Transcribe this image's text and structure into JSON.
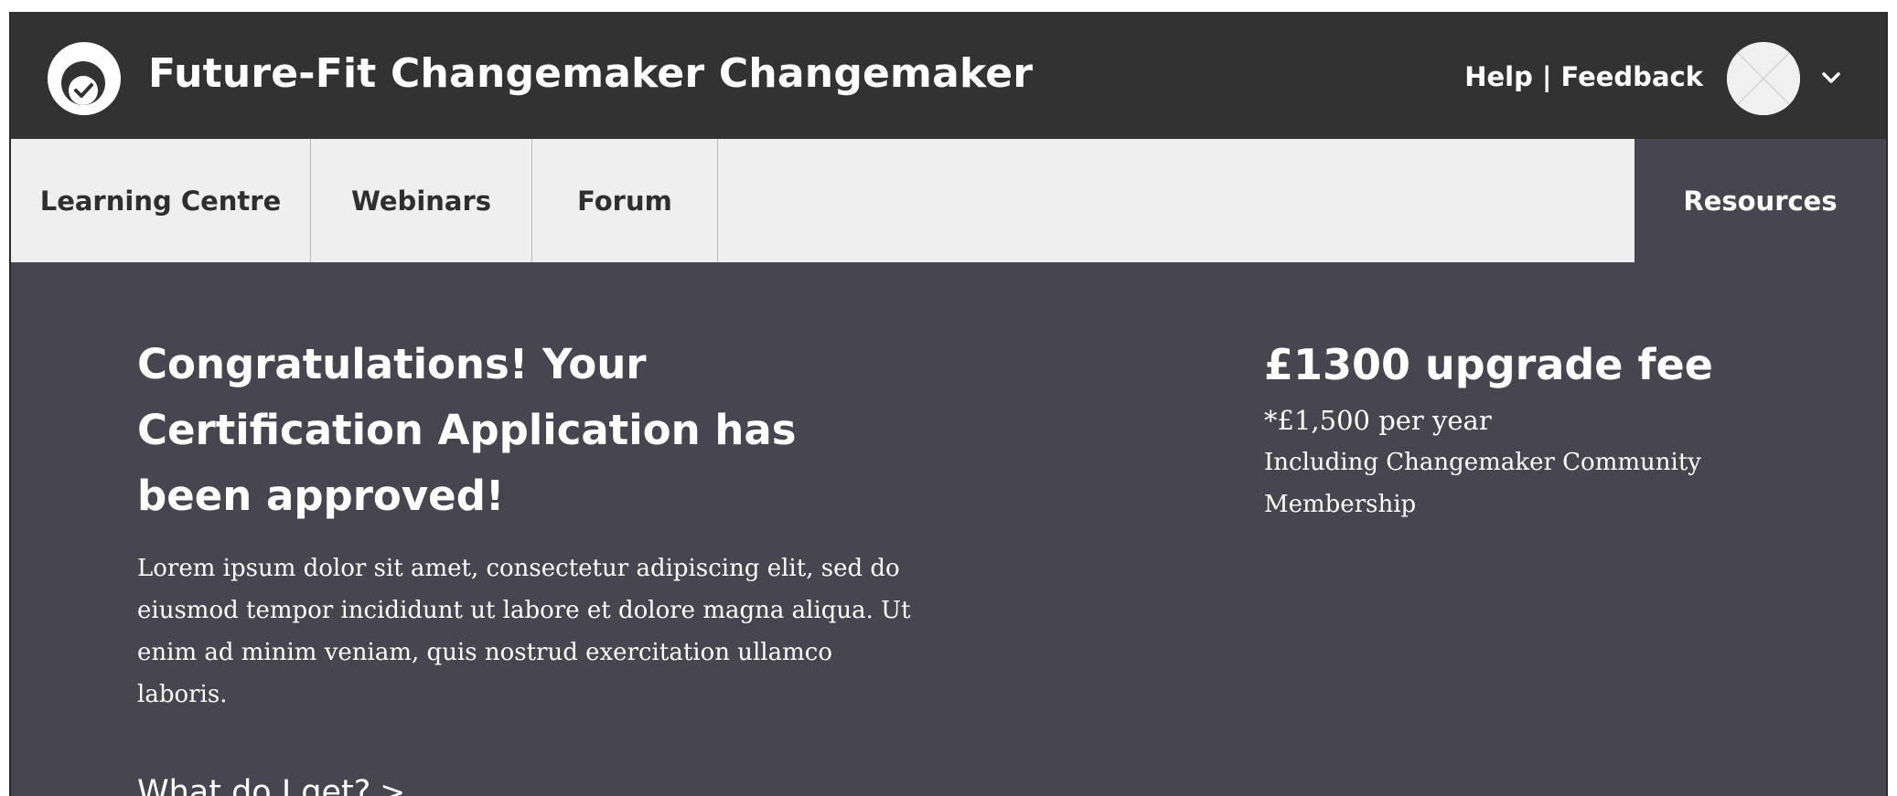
{
  "header": {
    "title": "Future-Fit Changemaker Changemaker",
    "help_label": "Help",
    "separator": "|",
    "feedback_label": "Feedback"
  },
  "nav": {
    "tabs": [
      {
        "label": "Learning Centre"
      },
      {
        "label": "Webinars"
      },
      {
        "label": "Forum"
      },
      {
        "label": "Resources"
      }
    ],
    "active_tab": "Resources"
  },
  "main": {
    "headline": "Congratulations! Your Certification Application has been approved!",
    "body": "Lorem ipsum dolor sit amet, consectetur adipiscing elit, sed do eiusmod tempor incididunt ut labore et dolore magna aliqua. Ut enim ad minim veniam, quis nostrud exercitation ullamco laboris.",
    "link_label": "What do I get?",
    "link_arrow": ">"
  },
  "pricing": {
    "fee": "£1300 upgrade fee",
    "per_year": "*£1,500 per year",
    "includes": "Including Changemaker Community Membership"
  },
  "icons": {
    "logo": "badge-check-icon",
    "avatar": "user-avatar-placeholder",
    "menu": "chevron-down-icon"
  },
  "colors": {
    "header_bg": "#323232",
    "nav_bg": "#efefef",
    "content_bg": "#474650",
    "text_light": "#ffffff",
    "text_dark": "#2f2f2f"
  }
}
